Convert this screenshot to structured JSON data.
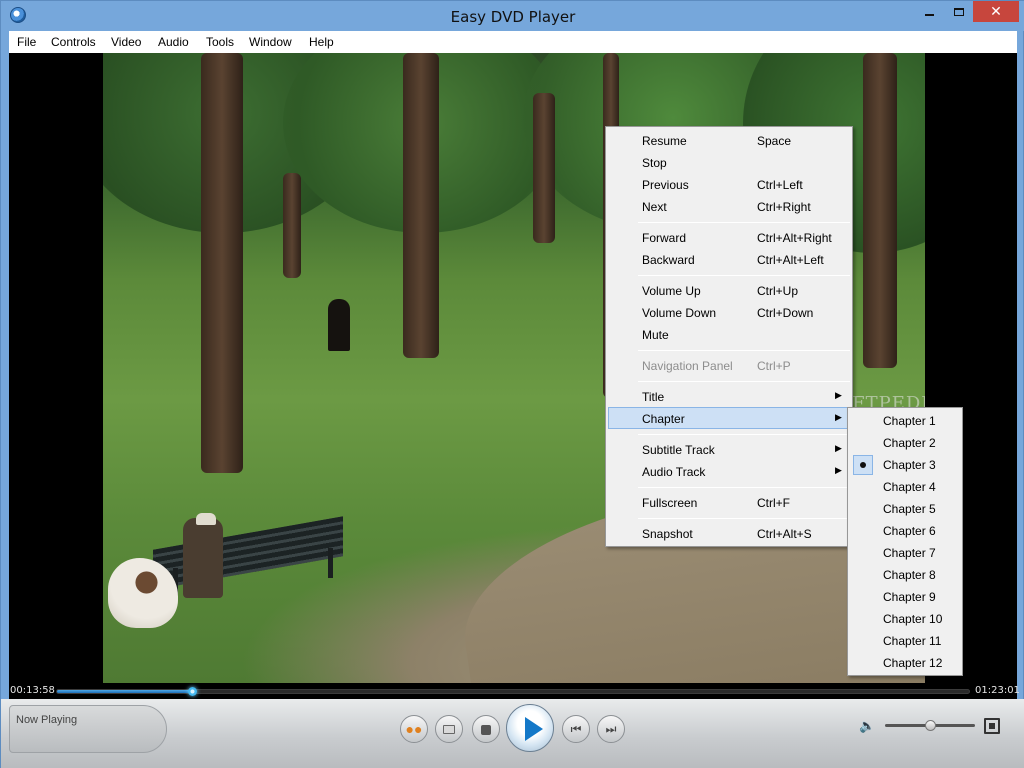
{
  "window": {
    "title": "Easy DVD Player",
    "controls": {
      "minimize": "minimize",
      "maximize": "maximize",
      "close": "✕"
    }
  },
  "menubar": {
    "items": [
      {
        "label": "File"
      },
      {
        "label": "Controls"
      },
      {
        "label": "Video"
      },
      {
        "label": "Audio"
      },
      {
        "label": "Tools"
      },
      {
        "label": "Window"
      },
      {
        "label": "Help"
      }
    ]
  },
  "video": {
    "watermark": "SOFTPEDIA"
  },
  "seek": {
    "current_time": "00:13:58",
    "total_time": "01:23:01",
    "progress_fraction": 0.1482
  },
  "controlbar": {
    "now_playing_label": "Now Playing",
    "volume_fraction": 0.5,
    "icons": [
      "navigation-panel-icon",
      "open-folder-icon",
      "stop-icon",
      "play-icon",
      "previous-icon",
      "next-icon",
      "volume-icon",
      "fullscreen-icon"
    ]
  },
  "context_menu": {
    "items": [
      {
        "label": "Resume",
        "shortcut": "Space"
      },
      {
        "label": "Stop",
        "shortcut": ""
      },
      {
        "label": "Previous",
        "shortcut": "Ctrl+Left"
      },
      {
        "label": "Next",
        "shortcut": "Ctrl+Right"
      },
      {
        "label": "Forward",
        "shortcut": "Ctrl+Alt+Right"
      },
      {
        "label": "Backward",
        "shortcut": "Ctrl+Alt+Left"
      },
      {
        "label": "Volume Up",
        "shortcut": "Ctrl+Up"
      },
      {
        "label": "Volume Down",
        "shortcut": "Ctrl+Down"
      },
      {
        "label": "Mute",
        "shortcut": ""
      },
      {
        "label": "Navigation Panel",
        "shortcut": "Ctrl+P",
        "disabled": true
      },
      {
        "label": "Title",
        "submenu": true
      },
      {
        "label": "Chapter",
        "submenu": true,
        "highlighted": true
      },
      {
        "label": "Subtitle Track",
        "submenu": true
      },
      {
        "label": "Audio Track",
        "submenu": true
      },
      {
        "label": "Fullscreen",
        "shortcut": "Ctrl+F"
      },
      {
        "label": "Snapshot",
        "shortcut": "Ctrl+Alt+S"
      }
    ]
  },
  "chapter_submenu": {
    "selected_index": 2,
    "items": [
      "Chapter 1",
      "Chapter 2",
      "Chapter 3",
      "Chapter 4",
      "Chapter 5",
      "Chapter 6",
      "Chapter 7",
      "Chapter 8",
      "Chapter 9",
      "Chapter 10",
      "Chapter 11",
      "Chapter 12"
    ]
  },
  "colors": {
    "title_bar": "#76a7db",
    "close_button": "#c7463d",
    "menu_highlight": "#cde0f5",
    "seek_fill": "#1f6fb8",
    "play_accent": "#1478c8"
  }
}
